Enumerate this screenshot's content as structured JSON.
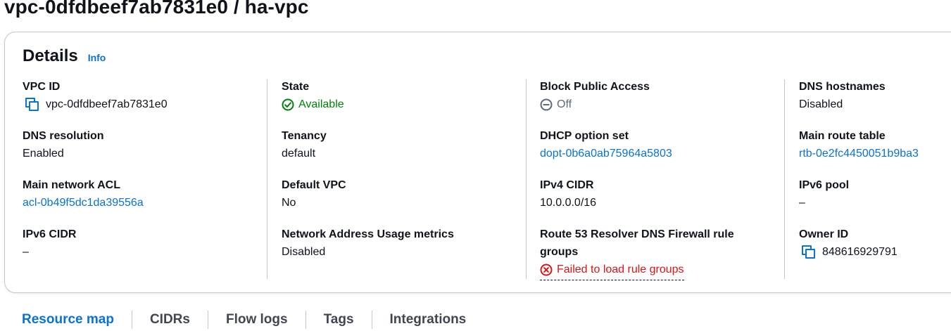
{
  "page": {
    "title": "vpc-0dfdbeef7ab7831e0 / ha-vpc"
  },
  "details": {
    "title": "Details",
    "info_label": "Info",
    "columns": [
      [
        {
          "label": "VPC ID",
          "value": "vpc-0dfdbeef7ab7831e0"
        },
        {
          "label": "DNS resolution",
          "value": "Enabled"
        },
        {
          "label": "Main network ACL",
          "value": "acl-0b49f5dc1da39556a"
        },
        {
          "label": "IPv6 CIDR",
          "value": "–"
        }
      ],
      [
        {
          "label": "State",
          "value": "Available"
        },
        {
          "label": "Tenancy",
          "value": "default"
        },
        {
          "label": "Default VPC",
          "value": "No"
        },
        {
          "label": "Network Address Usage metrics",
          "value": "Disabled"
        }
      ],
      [
        {
          "label": "Block Public Access",
          "value": "Off"
        },
        {
          "label": "DHCP option set",
          "value": "dopt-0b6a0ab75964a5803"
        },
        {
          "label": "IPv4 CIDR",
          "value": "10.0.0.0/16"
        },
        {
          "label_line1": "Route 53 Resolver DNS Firewall rule",
          "label_line2": "groups",
          "value": "Failed to load rule groups"
        }
      ],
      [
        {
          "label": "DNS hostnames",
          "value": "Disabled"
        },
        {
          "label": "Main route table",
          "value": "rtb-0e2fc4450051b9ba3"
        },
        {
          "label": "IPv6 pool",
          "value": "–"
        },
        {
          "label": "Owner ID",
          "value": "848616929791"
        }
      ]
    ]
  },
  "tabs": [
    {
      "label": "Resource map",
      "active": true
    },
    {
      "label": "CIDRs",
      "active": false
    },
    {
      "label": "Flow logs",
      "active": false
    },
    {
      "label": "Tags",
      "active": false
    },
    {
      "label": "Integrations",
      "active": false
    }
  ],
  "colors": {
    "link": "#0972d3",
    "success": "#037f0c",
    "error": "#d91515",
    "muted": "#5f6b7a",
    "border": "#c6c6cd"
  },
  "icons": [
    "copy-icon",
    "check-circle-icon",
    "minus-circle-icon",
    "error-circle-icon"
  ]
}
